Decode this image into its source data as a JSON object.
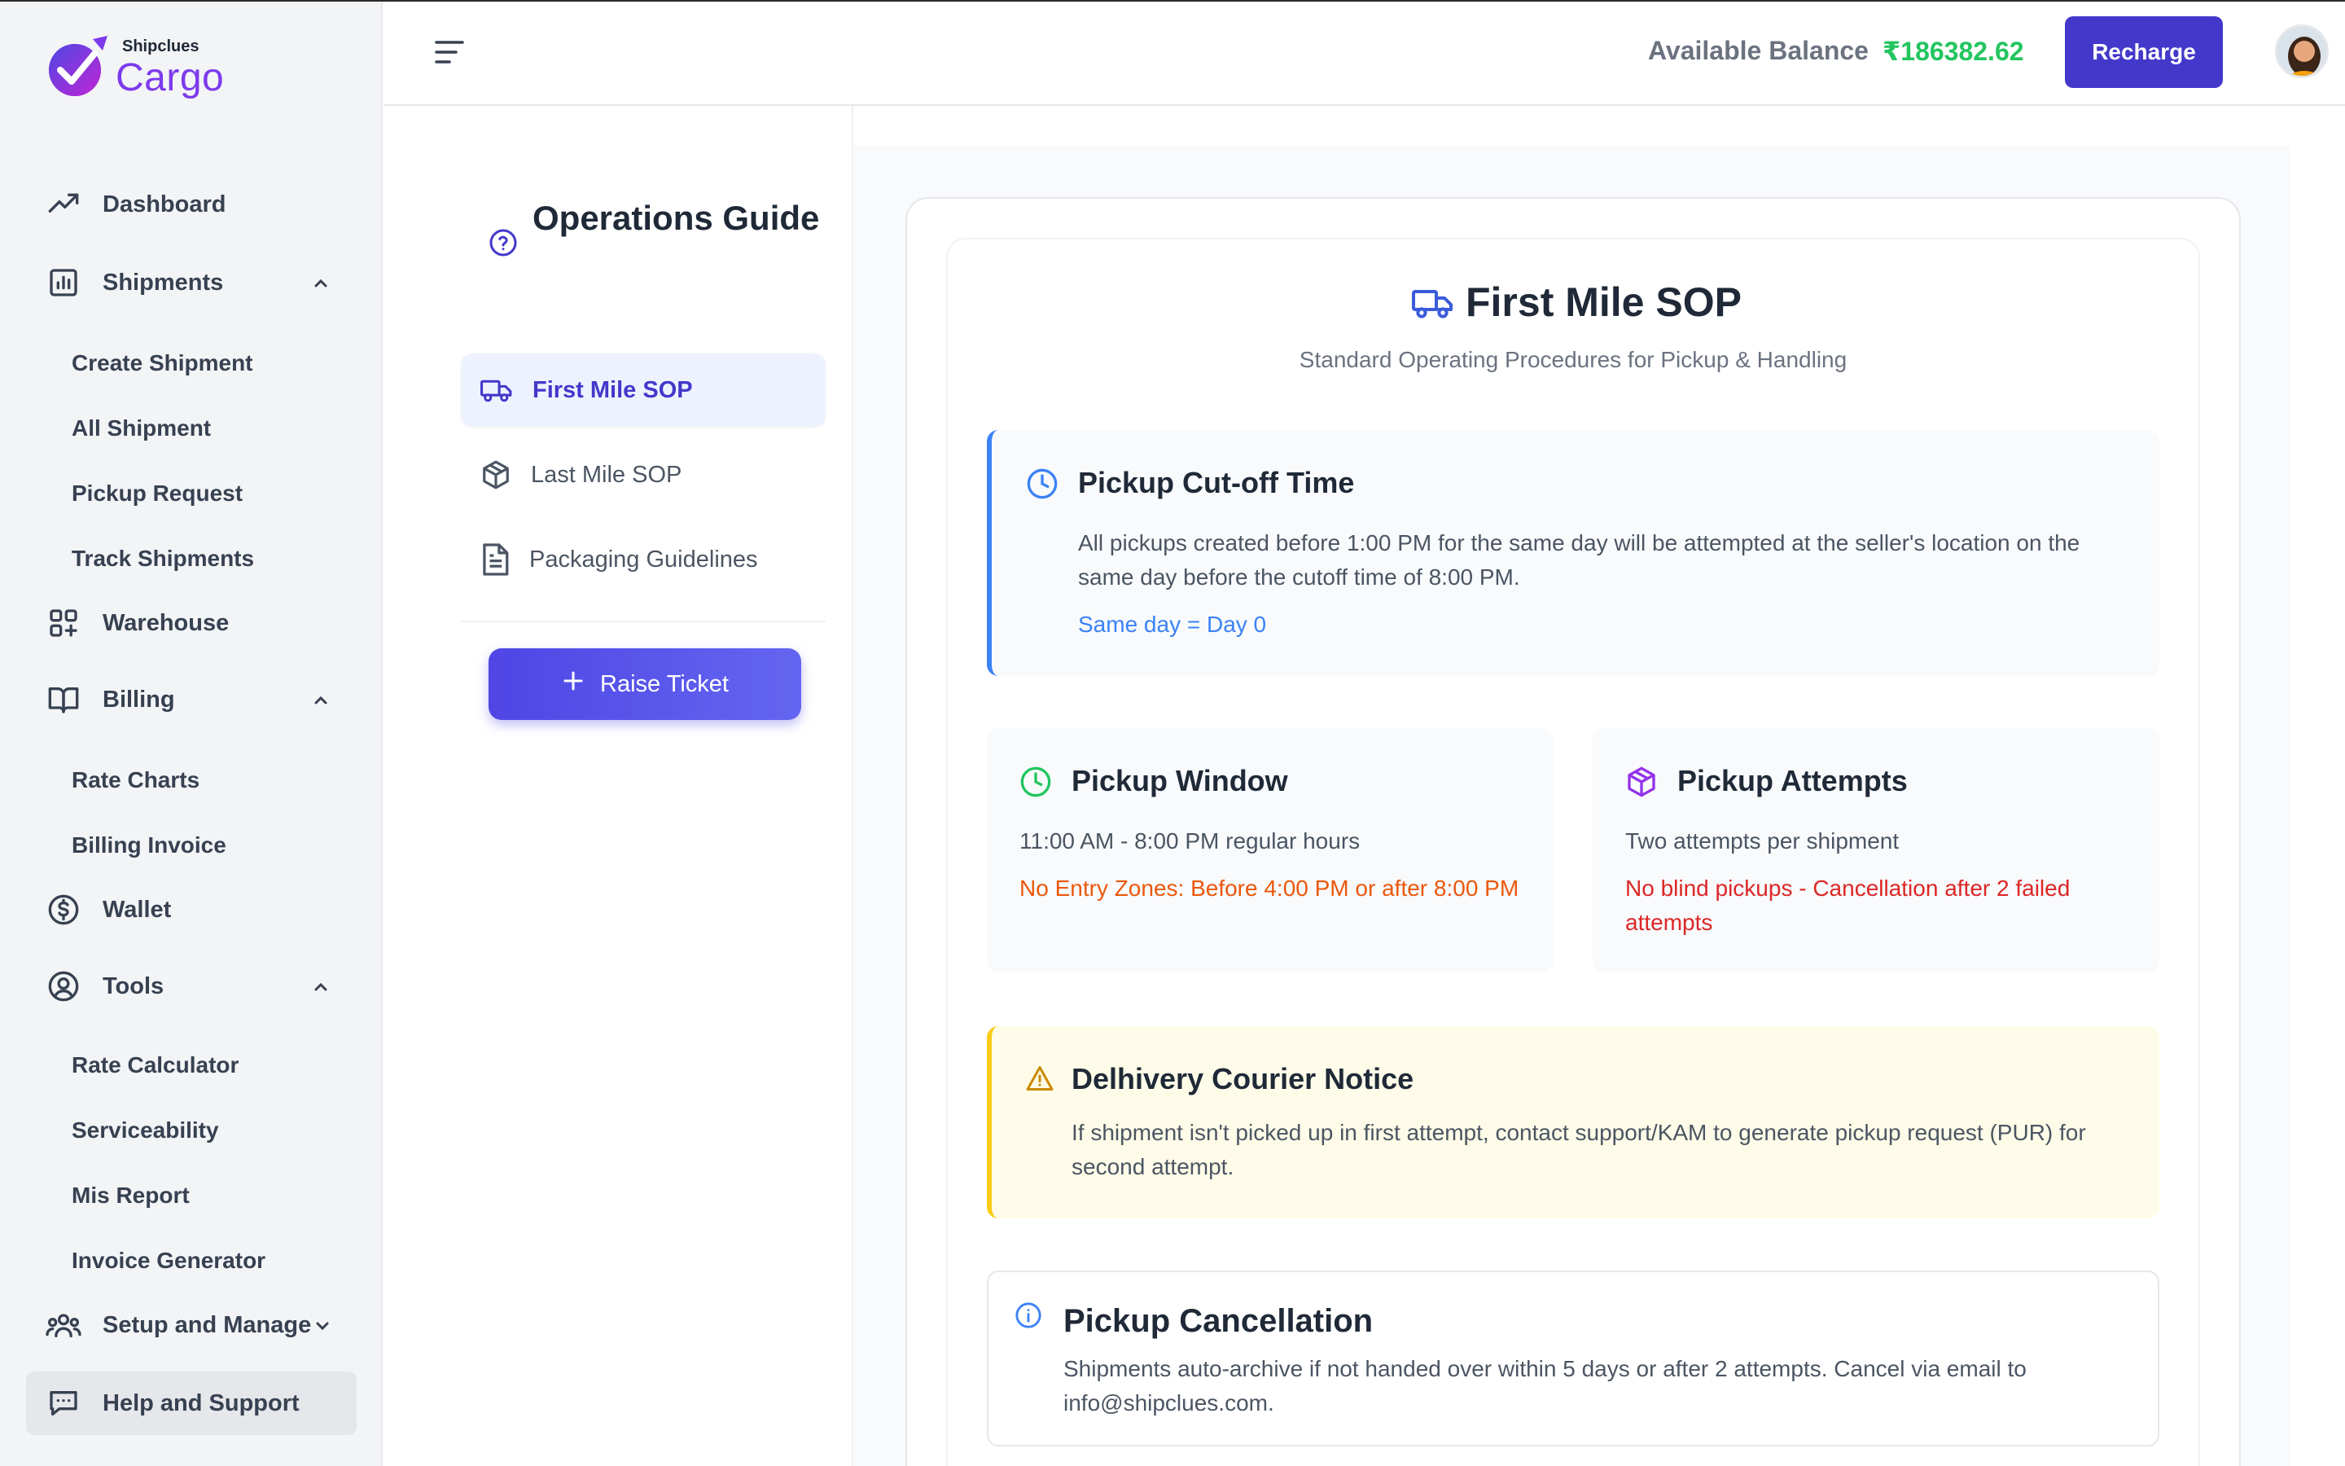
{
  "brand": {
    "small": "Shipclues",
    "big": "Cargo",
    "color": "#7c3aed"
  },
  "sidebar": {
    "items": [
      {
        "label": "Dashboard"
      },
      {
        "label": "Shipments"
      },
      {
        "label": "Warehouse"
      },
      {
        "label": "Billing"
      },
      {
        "label": "Wallet"
      },
      {
        "label": "Tools"
      },
      {
        "label": "Setup and Manage"
      },
      {
        "label": "Help and Support"
      }
    ],
    "shipments_sub": [
      "Create Shipment",
      "All Shipment",
      "Pickup Request",
      "Track Shipments"
    ],
    "billing_sub": [
      "Rate Charts",
      "Billing Invoice"
    ],
    "tools_sub": [
      "Rate Calculator",
      "Serviceability",
      "Mis Report",
      "Invoice Generator"
    ]
  },
  "header": {
    "balance_label": "Available Balance",
    "balance_value": "₹186382.62",
    "recharge_label": "Recharge"
  },
  "guide": {
    "title": "Operations Guide",
    "links": [
      "First Mile SOP",
      "Last Mile SOP",
      "Packaging Guidelines"
    ],
    "raise_ticket": "Raise Ticket"
  },
  "sop": {
    "title": "First Mile SOP",
    "subtitle": "Standard Operating Procedures for Pickup & Handling",
    "cutoff": {
      "heading": "Pickup Cut-off Time",
      "text": "All pickups created before 1:00 PM for the same day will be attempted at the seller's location on the same day before the cutoff time of 8:00 PM.",
      "note": "Same day = Day 0"
    },
    "window": {
      "heading": "Pickup Window",
      "text": "11:00 AM - 8:00 PM regular hours",
      "note": "No Entry Zones: Before 4:00 PM or after 8:00 PM"
    },
    "attempts": {
      "heading": "Pickup Attempts",
      "text": "Two attempts per shipment",
      "note": "No blind pickups - Cancellation after 2 failed attempts"
    },
    "notice": {
      "heading": "Delhivery Courier Notice",
      "text": "If shipment isn't picked up in first attempt, contact support/KAM to generate pickup request (PUR) for second attempt."
    },
    "cancellation": {
      "heading": "Pickup Cancellation",
      "text": "Shipments auto-archive if not handed over within 5 days or after 2 attempts. Cancel via email to info@shipclues.com."
    }
  },
  "colors": {
    "accent": "#4338ca",
    "balance": "#22c55e",
    "info_blue": "#3b82f6",
    "warning_orange": "#ea580c",
    "danger_red": "#dc2626",
    "notice_yellow": "#facc15"
  }
}
